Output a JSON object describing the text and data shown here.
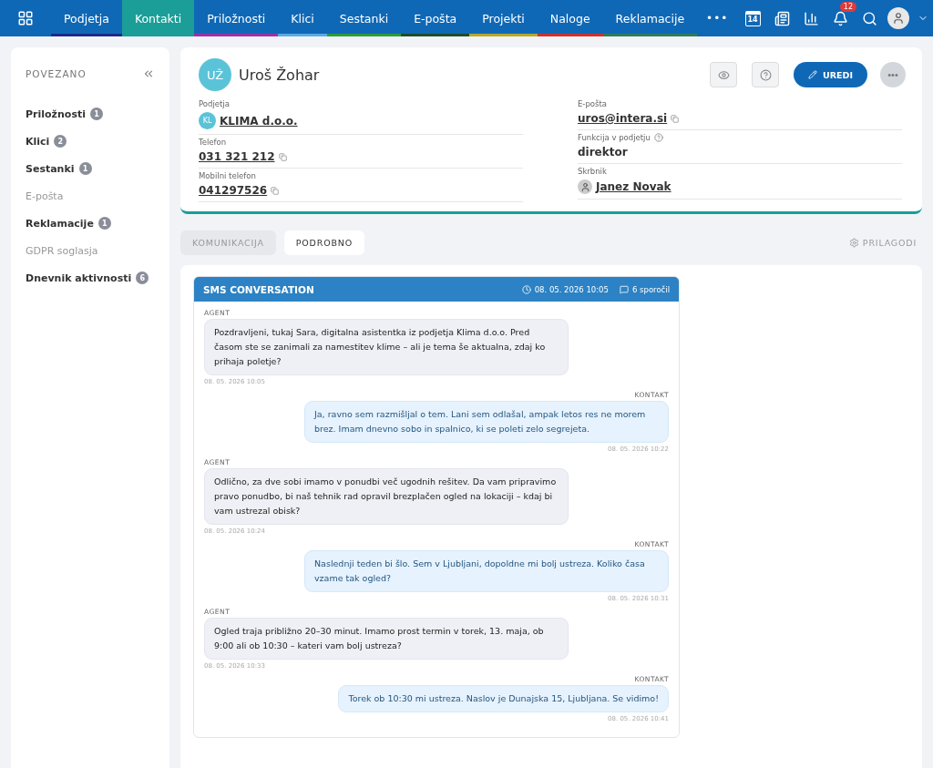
{
  "nav": {
    "items": [
      {
        "label": "Podjetja",
        "color": "#1b2a8c",
        "selected": false
      },
      {
        "label": "Kontakti",
        "color": "#1a9e97",
        "selected": true
      },
      {
        "label": "Priložnosti",
        "color": "#9c2fae",
        "selected": false
      },
      {
        "label": "Klici",
        "color": "#5aa9e6",
        "selected": false
      },
      {
        "label": "Sestanki",
        "color": "#2a9d3a",
        "selected": false
      },
      {
        "label": "E-pošta",
        "color": "#1e4d2b",
        "selected": false
      },
      {
        "label": "Projekti",
        "color": "#b5a82a",
        "selected": false
      },
      {
        "label": "Naloge",
        "color": "#d0312d",
        "selected": false
      },
      {
        "label": "Reklamacije",
        "color": "#2e7d5b",
        "selected": false
      }
    ],
    "more": "•••",
    "calendar_day": "14",
    "notifications": "12"
  },
  "sidebar": {
    "title": "POVEZANO",
    "items": [
      {
        "label": "Priložnosti",
        "count": "1",
        "disabled": false
      },
      {
        "label": "Klici",
        "count": "2",
        "disabled": false
      },
      {
        "label": "Sestanki",
        "count": "1",
        "disabled": false
      },
      {
        "label": "E-pošta",
        "disabled": true
      },
      {
        "label": "Reklamacije",
        "count": "1",
        "disabled": false
      },
      {
        "label": "GDPR soglasja",
        "disabled": true
      },
      {
        "label": "Dnevnik aktivnosti",
        "count": "6",
        "disabled": false
      }
    ]
  },
  "contact": {
    "initials": "UŽ",
    "name": "Uroš Žohar",
    "edit_button": "UREDI",
    "more_button": "•••",
    "columns": [
      [
        {
          "kind": "company",
          "label": "Podjetja",
          "value": "KLIMA d.o.o.",
          "badge": "KL"
        },
        {
          "kind": "copy",
          "label": "Telefon",
          "value": "031 321 212"
        },
        {
          "kind": "copy",
          "label": "Mobilni telefon",
          "value": "041297526"
        }
      ],
      [
        {
          "kind": "copy",
          "label": "E-pošta",
          "value": "uros@intera.si"
        },
        {
          "kind": "text",
          "label": "Funkcija v podjetju",
          "value": "direktor",
          "help": true
        },
        {
          "kind": "person",
          "label": "Skrbnik",
          "value": "Janez Novak"
        }
      ]
    ]
  },
  "tabs": [
    {
      "label": "KOMUNIKACIJA",
      "selected": false
    },
    {
      "label": "PODROBNO",
      "selected": true
    }
  ],
  "customize": "PRILAGODI",
  "conversation": {
    "title": "SMS CONVERSATION",
    "date": "08. 05. 2026 10:05",
    "count": "6 sporočil",
    "messages": [
      {
        "kind": "agent",
        "sender": "AGENT",
        "text": "Pozdravljeni, tukaj Sara, digitalna asistentka iz podjetja Klima d.o.o. Pred časom ste se zanimali za namestitev klime – ali je tema še aktualna, zdaj ko prihaja poletje?",
        "time": "08. 05. 2026 10:05"
      },
      {
        "kind": "contact",
        "sender": "KONTAKT",
        "text": "Ja, ravno sem razmišljal o tem. Lani sem odlašal, ampak letos res ne morem brez. Imam dnevno sobo in spalnico, ki se poleti zelo segrejeta.",
        "time": "08. 05. 2026 10:22"
      },
      {
        "kind": "agent",
        "sender": "AGENT",
        "text": "Odlično, za dve sobi imamo v ponudbi več ugodnih rešitev. Da vam pripravimo pravo ponudbo, bi naš tehnik rad opravil brezplačen ogled na lokaciji – kdaj bi vam ustrezal obisk?",
        "time": "08. 05. 2026 10:24"
      },
      {
        "kind": "contact",
        "sender": "KONTAKT",
        "text": "Naslednji teden bi šlo. Sem v Ljubljani, dopoldne mi bolj ustreza. Koliko časa vzame tak ogled?",
        "time": "08. 05. 2026 10:31"
      },
      {
        "kind": "agent",
        "sender": "AGENT",
        "text": "Ogled traja približno 20–30 minut. Imamo prost termin v torek, 13. maja, ob 9:00 ali ob 10:30 – kateri vam bolj ustreza?",
        "time": "08. 05. 2026 10:33"
      },
      {
        "kind": "contact",
        "sender": "KONTAKT",
        "text": "Torek ob 10:30 mi ustreza. Naslov je Dunajska 15, Ljubljana. Se vidimo!",
        "time": "08. 05. 2026 10:41"
      }
    ]
  }
}
